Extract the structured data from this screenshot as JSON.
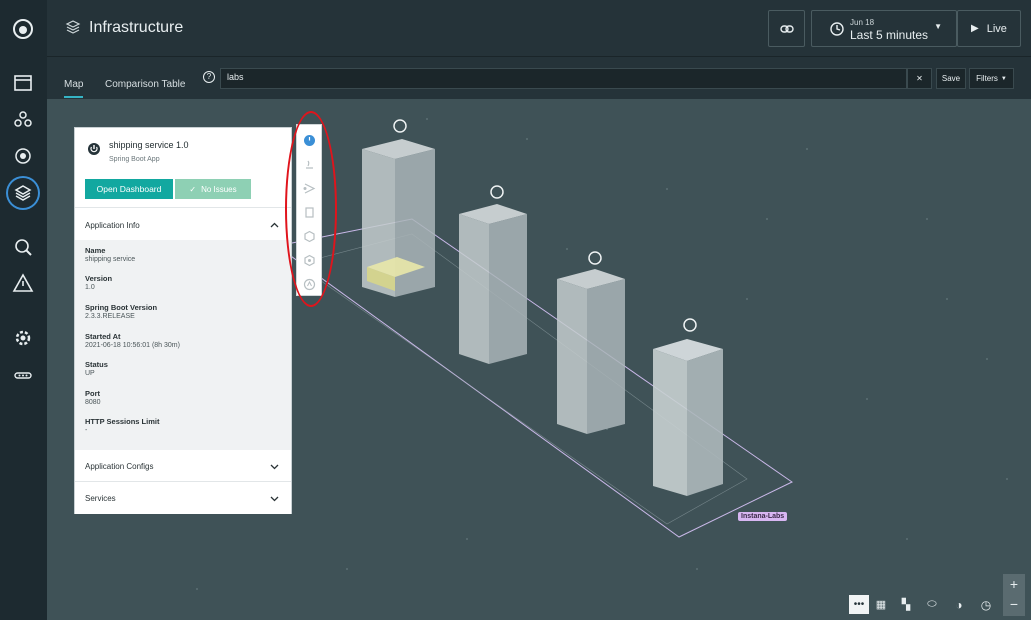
{
  "header": {
    "title": "Infrastructure",
    "time_date": "Jun 18",
    "time_range": "Last 5 minutes",
    "live_label": "Live"
  },
  "tabs": [
    {
      "label": "Map",
      "active": true
    },
    {
      "label": "Comparison Table",
      "active": false
    }
  ],
  "search": {
    "value": "labs",
    "save_label": "Save",
    "filters_label": "Filters"
  },
  "panel": {
    "title": "shipping service 1.0",
    "subtitle": "Spring Boot App",
    "open_dashboard": "Open Dashboard",
    "no_issues": "No Issues",
    "section_app_info": "Application Info",
    "fields": [
      {
        "key": "Name",
        "value": "shipping service"
      },
      {
        "key": "Version",
        "value": "1.0"
      },
      {
        "key": "Spring Boot Version",
        "value": "2.3.3.RELEASE"
      },
      {
        "key": "Started At",
        "value": "2021-06-18 10:56:01 (8h 30m)"
      },
      {
        "key": "Status",
        "value": "UP"
      },
      {
        "key": "Port",
        "value": "8080"
      },
      {
        "key": "HTTP Sessions Limit",
        "value": "-"
      }
    ],
    "section_configs": "Application Configs",
    "section_services": "Services"
  },
  "map": {
    "zone_label": "Instana-Labs",
    "accent_color": "#12a8a0",
    "highlight_color": "#e0141c"
  }
}
